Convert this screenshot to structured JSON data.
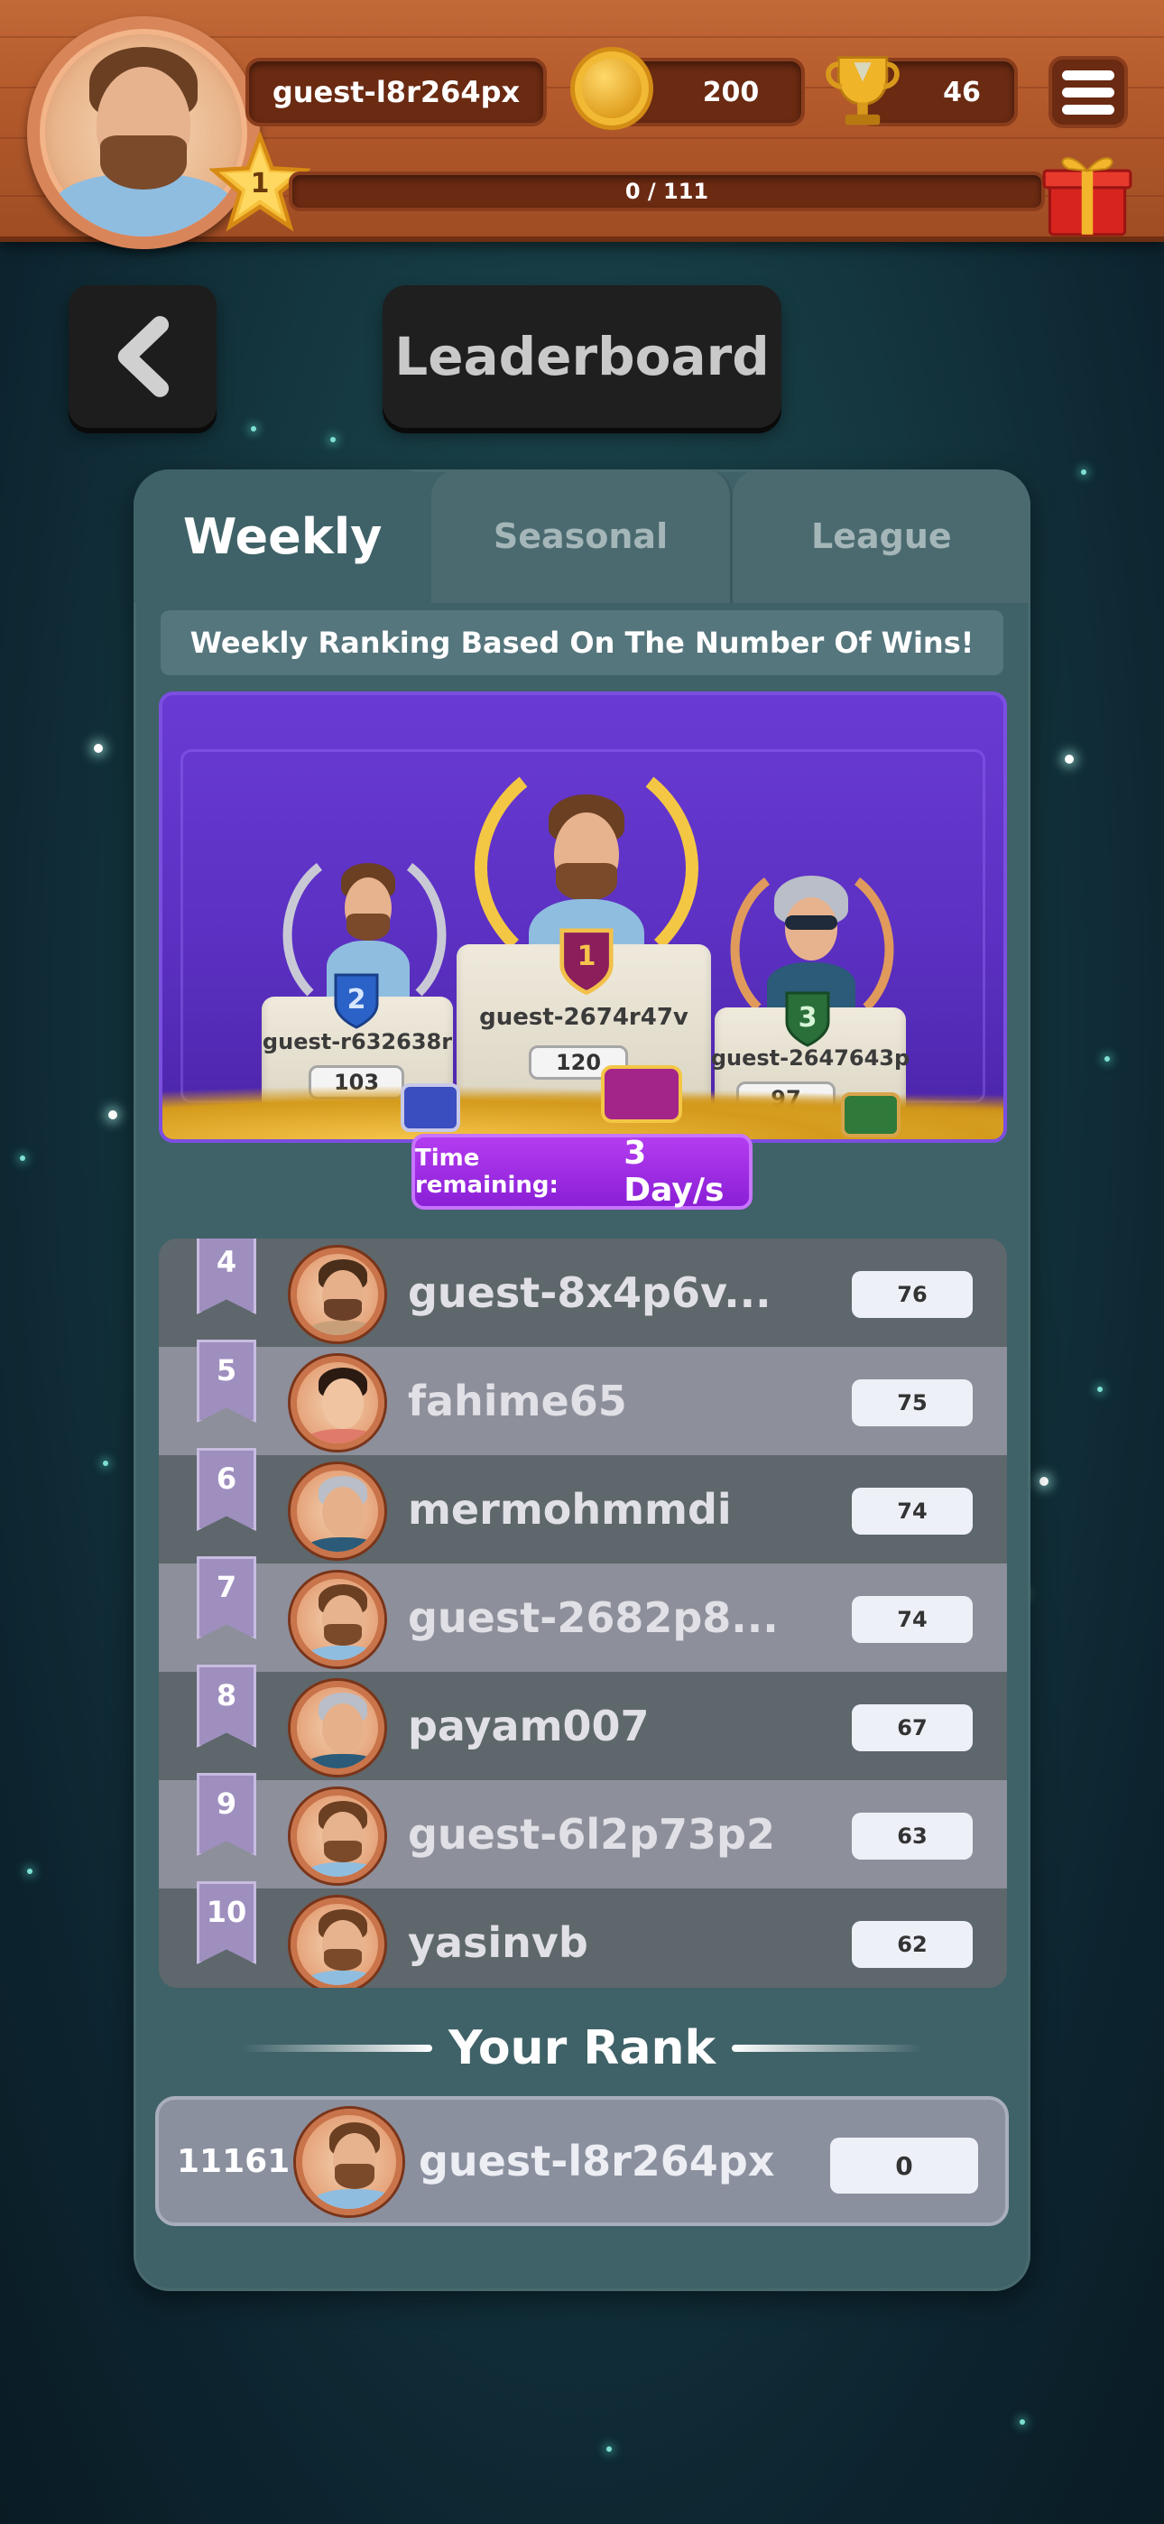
{
  "player": {
    "username": "guest-l8r264px",
    "level": "1",
    "coins": "200",
    "trophies": "46",
    "xp": "0 / 111",
    "xp_fraction": 0
  },
  "header": {
    "title": "Leaderboard"
  },
  "tabs": [
    {
      "label": "Weekly",
      "active": true
    },
    {
      "label": "Seasonal",
      "active": false
    },
    {
      "label": "League",
      "active": false
    }
  ],
  "subtitle": "Weekly Ranking Based On The Number Of Wins!",
  "podium": {
    "first": {
      "rank": "1",
      "name": "guest-2674r47v",
      "score": "120"
    },
    "second": {
      "rank": "2",
      "name": "guest-r632638r",
      "score": "103"
    },
    "third": {
      "rank": "3",
      "name": "guest-2647643p",
      "score": "97"
    }
  },
  "timer": {
    "label": "Time remaining:",
    "value": "3 Day/s"
  },
  "rows": [
    {
      "rank": "4",
      "name": "guest-8x4p6v...",
      "score": "76"
    },
    {
      "rank": "5",
      "name": "fahime65",
      "score": "75"
    },
    {
      "rank": "6",
      "name": "mermohmmdi",
      "score": "74"
    },
    {
      "rank": "7",
      "name": "guest-2682p8...",
      "score": "74"
    },
    {
      "rank": "8",
      "name": "payam007",
      "score": "67"
    },
    {
      "rank": "9",
      "name": "guest-6l2p73p2",
      "score": "63"
    },
    {
      "rank": "10",
      "name": "yasinvb",
      "score": "62"
    }
  ],
  "your_rank": {
    "title": "Your Rank",
    "rank": "11161",
    "name": "guest-l8r264px",
    "score": "0"
  },
  "colors": {
    "wood": "#b45a2c",
    "panel": "#3f6268",
    "podium_purple": "#5a2fc0",
    "timer_purple": "#8a1fd6"
  },
  "icons": [
    "back-arrow-icon",
    "coin-icon",
    "trophy-icon",
    "menu-icon",
    "gift-icon",
    "level-star-icon"
  ]
}
